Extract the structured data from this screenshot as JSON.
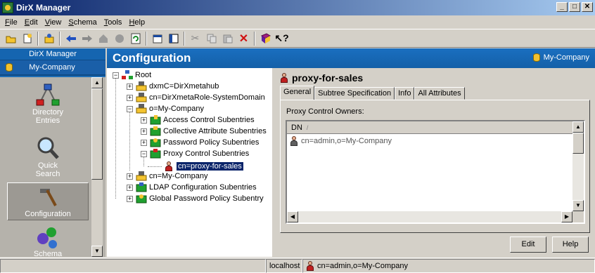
{
  "window": {
    "title": "DirX Manager",
    "buttons": [
      "_",
      "□",
      "✕"
    ]
  },
  "menu": [
    {
      "pre": "",
      "u": "F",
      "post": "ile"
    },
    {
      "pre": "",
      "u": "E",
      "post": "dit"
    },
    {
      "pre": "",
      "u": "V",
      "post": "iew"
    },
    {
      "pre": "",
      "u": "S",
      "post": "chema"
    },
    {
      "pre": "",
      "u": "T",
      "post": "ools"
    },
    {
      "pre": "",
      "u": "H",
      "post": "elp"
    }
  ],
  "toolbar": {
    "icons": [
      "open-folder-icon",
      "new-icon",
      "properties-icon",
      "back-icon",
      "forward-icon",
      "home-icon",
      "stop-icon",
      "refresh-icon",
      "properties-window-icon",
      "view-pane-icon",
      "cut-icon",
      "copy-icon",
      "paste-icon",
      "delete-icon",
      "book-icon",
      "help-pointer-icon"
    ]
  },
  "left_pane": {
    "header": "DirX Manager",
    "company": "My-Company",
    "shortcuts": [
      {
        "label_line1": "Directory",
        "label_line2": "Entries",
        "icon": "directory-entries-icon"
      },
      {
        "label_line1": "Quick",
        "label_line2": "Search",
        "icon": "quick-search-icon"
      },
      {
        "label_line1": "Configuration",
        "label_line2": "",
        "icon": "configuration-icon",
        "active": true
      },
      {
        "label_line1": "Schema",
        "label_line2": "",
        "icon": "schema-icon"
      }
    ]
  },
  "main_header": {
    "title": "Configuration",
    "company": "My-Company"
  },
  "tree": {
    "root": "Root",
    "items": [
      {
        "label": "dxmC=DirXmetahub",
        "expander": "+"
      },
      {
        "label": "cn=DirXmetaRole-SystemDomain",
        "expander": "+"
      },
      {
        "label": "o=My-Company",
        "expander": "−"
      },
      {
        "label": "Access Control Subentries",
        "expander": "+"
      },
      {
        "label": "Collective Attribute Subentries",
        "expander": "+"
      },
      {
        "label": "Password Policy Subentries",
        "expander": "+"
      },
      {
        "label": "Proxy Control Subentries",
        "expander": "−"
      },
      {
        "label": "cn=proxy-for-sales",
        "expander": ""
      },
      {
        "label": "cn=My-Company",
        "expander": "+"
      },
      {
        "label": "LDAP Configuration Subentries",
        "expander": "+"
      },
      {
        "label": "Global Password Policy Subentry",
        "expander": "+"
      }
    ]
  },
  "detail": {
    "title": "proxy-for-sales",
    "tabs": [
      "General",
      "Subtree Specification",
      "Info",
      "All Attributes"
    ],
    "owners_label": "Proxy Control Owners:",
    "list_header": "DN",
    "list_sort": "/",
    "rows": [
      "cn=admin,o=My-Company"
    ],
    "edit_button": "Edit",
    "help_button": "Help"
  },
  "status": {
    "host": "localhost",
    "user": "cn=admin,o=My-Company"
  }
}
